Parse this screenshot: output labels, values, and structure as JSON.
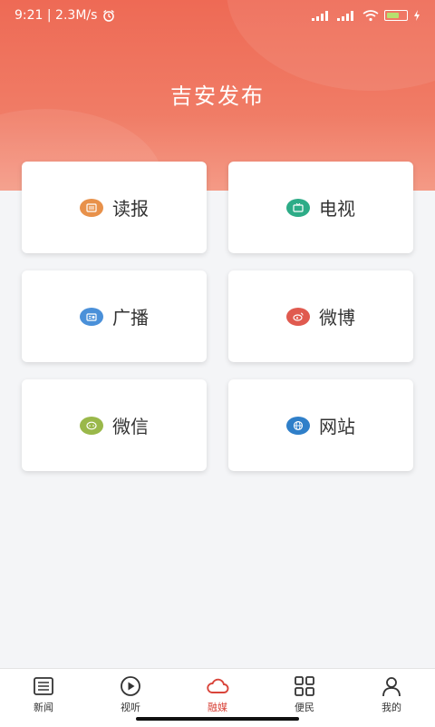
{
  "status_bar": {
    "time_speed": "9:21 | 2.3M/s"
  },
  "header": {
    "title": "吉安发布"
  },
  "cards": [
    {
      "label": "读报",
      "icon": "newspaper-icon",
      "color": "#e8914a"
    },
    {
      "label": "电视",
      "icon": "tv-icon",
      "color": "#2dac87"
    },
    {
      "label": "广播",
      "icon": "radio-icon",
      "color": "#4a90d9"
    },
    {
      "label": "微博",
      "icon": "weibo-icon",
      "color": "#e05a4f"
    },
    {
      "label": "微信",
      "icon": "wechat-icon",
      "color": "#9ab84a"
    },
    {
      "label": "网站",
      "icon": "website-icon",
      "color": "#2f7fc9"
    }
  ],
  "tabbar": {
    "items": [
      {
        "label": "新闻",
        "icon": "list-icon"
      },
      {
        "label": "视听",
        "icon": "play-icon"
      },
      {
        "label": "融媒",
        "icon": "cloud-icon",
        "active": true
      },
      {
        "label": "便民",
        "icon": "grid-icon"
      },
      {
        "label": "我的",
        "icon": "user-icon"
      }
    ]
  },
  "colors": {
    "header": "#ee6a55",
    "active_tab": "#d9443a"
  }
}
